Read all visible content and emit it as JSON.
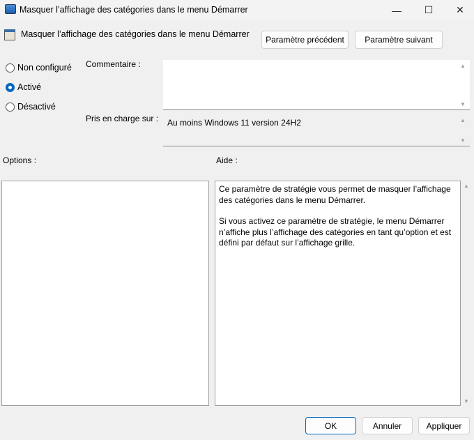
{
  "window": {
    "title": "Masquer l’affichage des catégories dans le menu Démarrer",
    "minimize": "—",
    "maximize": "☐",
    "close": "✕"
  },
  "header": {
    "title": "Masquer l’affichage des catégories dans le menu Démarrer",
    "prev_button": "Paramètre précédent",
    "next_button": "Paramètre suivant"
  },
  "state": {
    "options": [
      {
        "label": "Non configuré",
        "selected": false
      },
      {
        "label": "Activé",
        "selected": true
      },
      {
        "label": "Désactivé",
        "selected": false
      }
    ]
  },
  "comment": {
    "label": "Commentaire :",
    "value": ""
  },
  "supported": {
    "label": "Pris en charge sur :",
    "value": "Au moins Windows 11 version 24H2"
  },
  "options_label": "Options :",
  "help": {
    "label": "Aide :",
    "paragraphs": [
      "Ce paramètre de stratégie vous permet de masquer l’affichage des catégories dans le menu Démarrer.",
      "Si vous activez ce paramètre de stratégie, le menu Démarrer n’affiche plus l’affichage des catégories en tant qu’option et est défini par défaut sur l’affichage grille."
    ]
  },
  "footer": {
    "ok": "OK",
    "cancel": "Annuler",
    "apply": "Appliquer"
  }
}
